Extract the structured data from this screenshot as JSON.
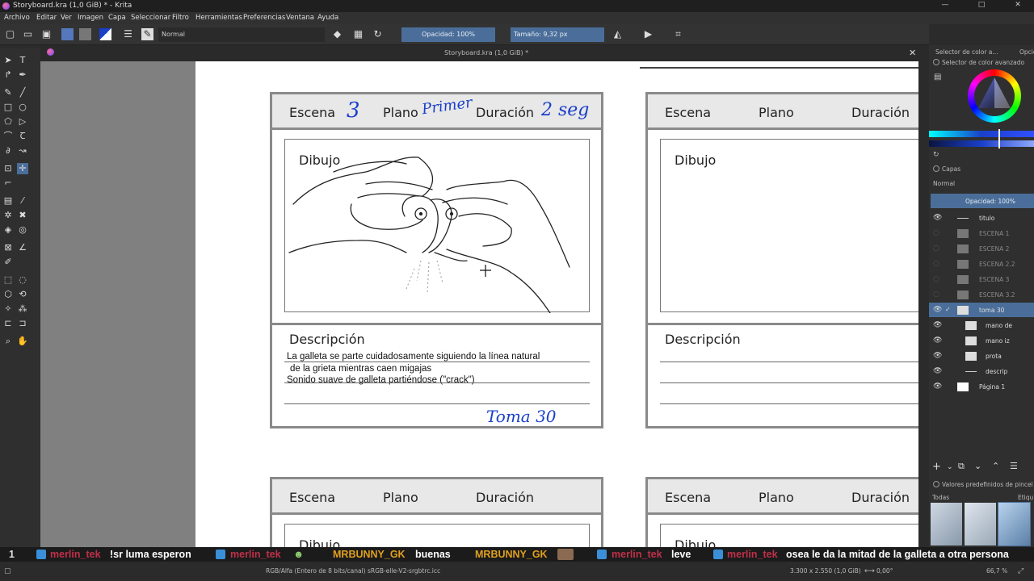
{
  "window": {
    "title": "Storyboard.kra (1,0 GiB) * - Krita",
    "minimize": "—",
    "maximize": "□",
    "close": "✕"
  },
  "menu": [
    "Archivo",
    "Editar",
    "Ver",
    "Imagen",
    "Capa",
    "Seleccionar",
    "Filtro",
    "Herramientas",
    "Preferencias",
    "Ventana",
    "Ayuda"
  ],
  "toolbar": {
    "blend_mode": "Normal",
    "opacity": "Opacidad: 100%",
    "size": "Tamaño: 9,32 px"
  },
  "document_tab": {
    "title": "Storyboard.kra (1,0 GiB) *",
    "close": "✕"
  },
  "storyboard": {
    "panel1": {
      "escena_label": "Escena",
      "escena_value": "3",
      "plano_label": "Plano",
      "plano_value": "Primer",
      "duracion_label": "Duración",
      "duracion_value": "2 seg",
      "dibujo_label": "Dibujo",
      "descripcion_label": "Descripción",
      "desc_line1": "La galleta se parte cuidadosamente siguiendo la línea natural",
      "desc_line2": "de la grieta mientras caen migajas",
      "desc_line3": "Sonido suave de galleta partiéndose (\"crack\")",
      "toma": "Toma 30"
    },
    "panel2": {
      "escena_label": "Escena",
      "plano_label": "Plano",
      "duracion_label": "Duración",
      "dibujo_label": "Dibujo",
      "descripcion_label": "Descripción"
    },
    "panel3": {
      "escena_label": "Escena",
      "plano_label": "Plano",
      "duracion_label": "Duración",
      "dibujo_label": "Dibujo"
    },
    "panel4": {
      "escena_label": "Escena",
      "plano_label": "Plano",
      "duracion_label": "Duración",
      "dibujo_label": "Dibujo"
    }
  },
  "right_dock": {
    "tab_color": "Selector de color a...",
    "tab_options": "Opcione",
    "color_panel_title": "Selector de color avanzado",
    "layers_title": "Capas",
    "blend_mode": "Normal",
    "opacity": "Opacidad:  100%",
    "layers": [
      {
        "name": "titulo",
        "visible": true,
        "active": false
      },
      {
        "name": "ESCENA 1",
        "visible": false,
        "active": false
      },
      {
        "name": "ESCENA 2",
        "visible": false,
        "active": false
      },
      {
        "name": "ESCENA 2.2",
        "visible": false,
        "active": false
      },
      {
        "name": "ESCENA 3",
        "visible": false,
        "active": false
      },
      {
        "name": "ESCENA 3.2",
        "visible": false,
        "active": false
      },
      {
        "name": "toma 30",
        "visible": true,
        "active": true
      },
      {
        "name": "mano de",
        "visible": true,
        "active": false
      },
      {
        "name": "mano iz",
        "visible": true,
        "active": false
      },
      {
        "name": "prota",
        "visible": true,
        "active": false
      },
      {
        "name": "descrip",
        "visible": true,
        "active": false
      },
      {
        "name": "Página 1",
        "visible": true,
        "active": false
      }
    ],
    "brush_presets_title": "Valores predefinidos de pincel",
    "brush_filter": "Todas",
    "brush_tag": "Etiqu"
  },
  "chat": {
    "count": "1",
    "messages": [
      {
        "user": "merlin_tek",
        "text": "!sr luma esperon",
        "user_color": "#c0304a"
      },
      {
        "user": "merlin_tek",
        "text": "",
        "user_color": "#c0304a"
      },
      {
        "user": "MRBUNNY_GK",
        "text": "buenas",
        "user_color": "#e0a020"
      },
      {
        "user": "MRBUNNY_GK",
        "text": "",
        "user_color": "#e0a020"
      },
      {
        "user": "merlin_tek",
        "text": "leve",
        "user_color": "#c0304a"
      },
      {
        "user": "merlin_tek",
        "text": "osea le da la mitad de la galleta a otra persona",
        "user_color": "#c0304a"
      }
    ]
  },
  "status": {
    "color_info": "RGB/Alfa (Entero de 8 bits/canal)  sRGB-elle-V2-srgbtrc.icc",
    "dimensions": "3.300 x 2.550 (1,0 GiB)",
    "rotation": "0,00°",
    "zoom": "66,7 %"
  },
  "colors": {
    "accent": "#4a6e99",
    "handwriting": "#1a3fc9",
    "frame": "#8a8a8a"
  }
}
